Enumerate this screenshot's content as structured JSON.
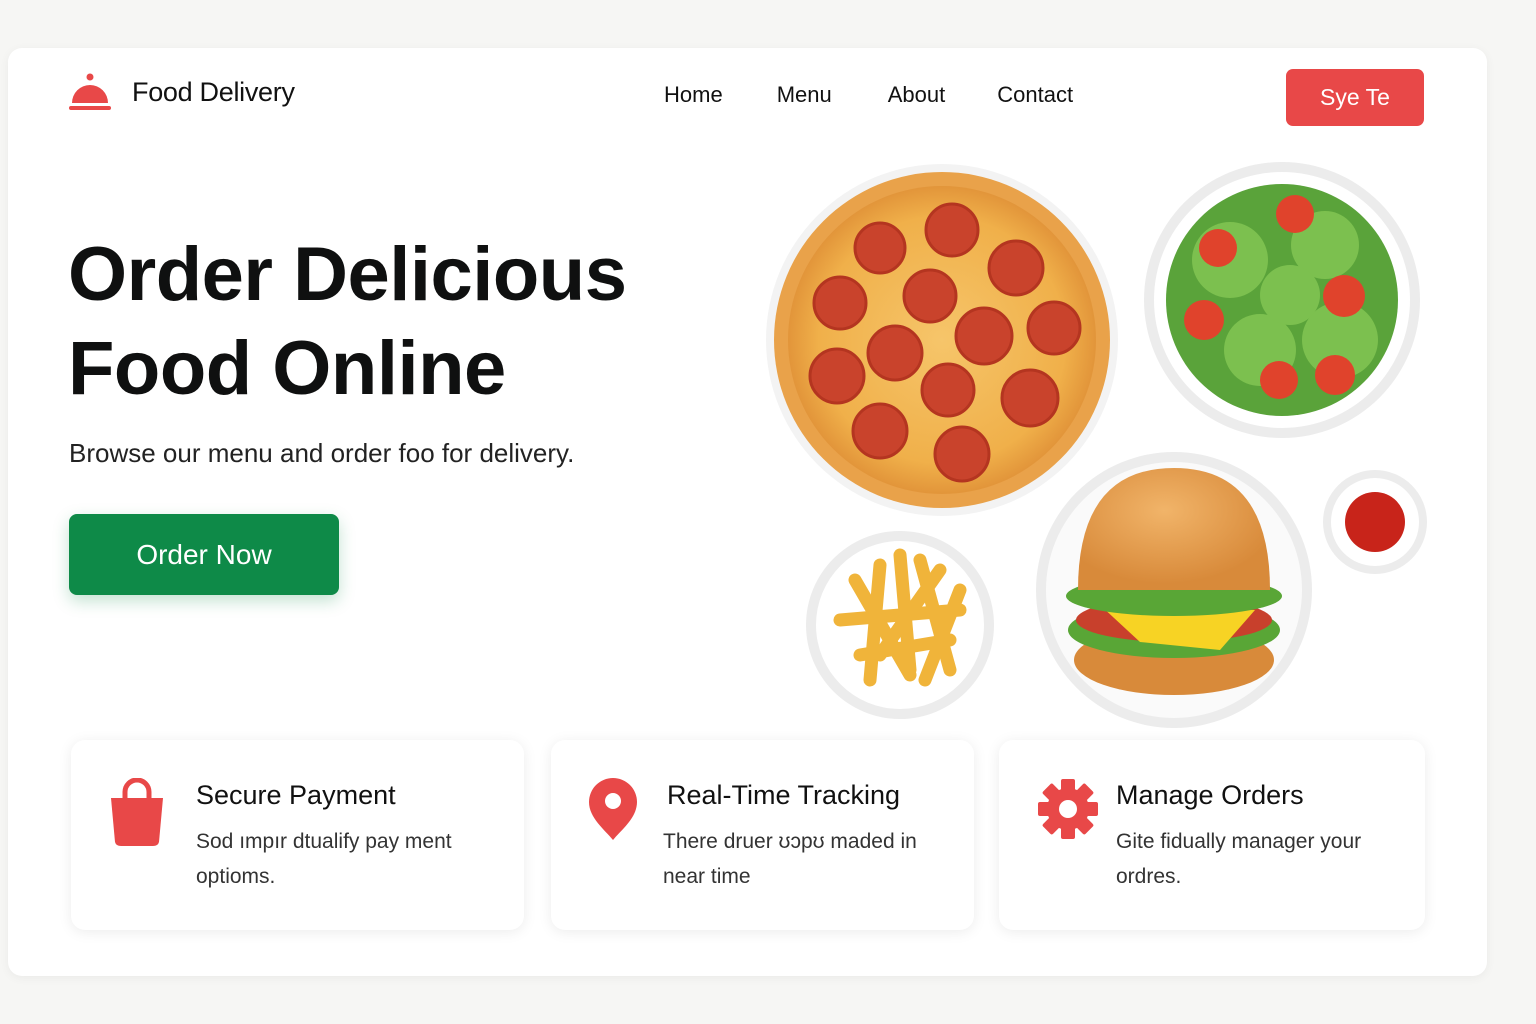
{
  "brand": {
    "name": "Food Delivery",
    "icon": "cloche-icon"
  },
  "nav": {
    "items": [
      "Home",
      "Menu",
      "About",
      "Contact"
    ]
  },
  "header_cta": "Sye Te",
  "hero": {
    "title_line1": "Order Delicious",
    "title_line2": "Food Online",
    "subtitle": "Browse our menu and order foo for delivery.",
    "cta": "Order Now"
  },
  "features": [
    {
      "icon": "shopping-bag-icon",
      "title": "Secure Payment",
      "desc_line1": "Sod ımpır dtualify pay ment",
      "desc_line2": "optioms."
    },
    {
      "icon": "map-pin-icon",
      "title": "Real-Time Tracking",
      "desc_line1": "There druer ʊɔpʊ maded in",
      "desc_line2": "near time"
    },
    {
      "icon": "gear-icon",
      "title": "Manage Orders",
      "desc_line1": "Gite fidually manager your",
      "desc_line2": "ordres."
    }
  ],
  "colors": {
    "accent_red": "#e84848",
    "cta_green": "#0e8a48"
  }
}
